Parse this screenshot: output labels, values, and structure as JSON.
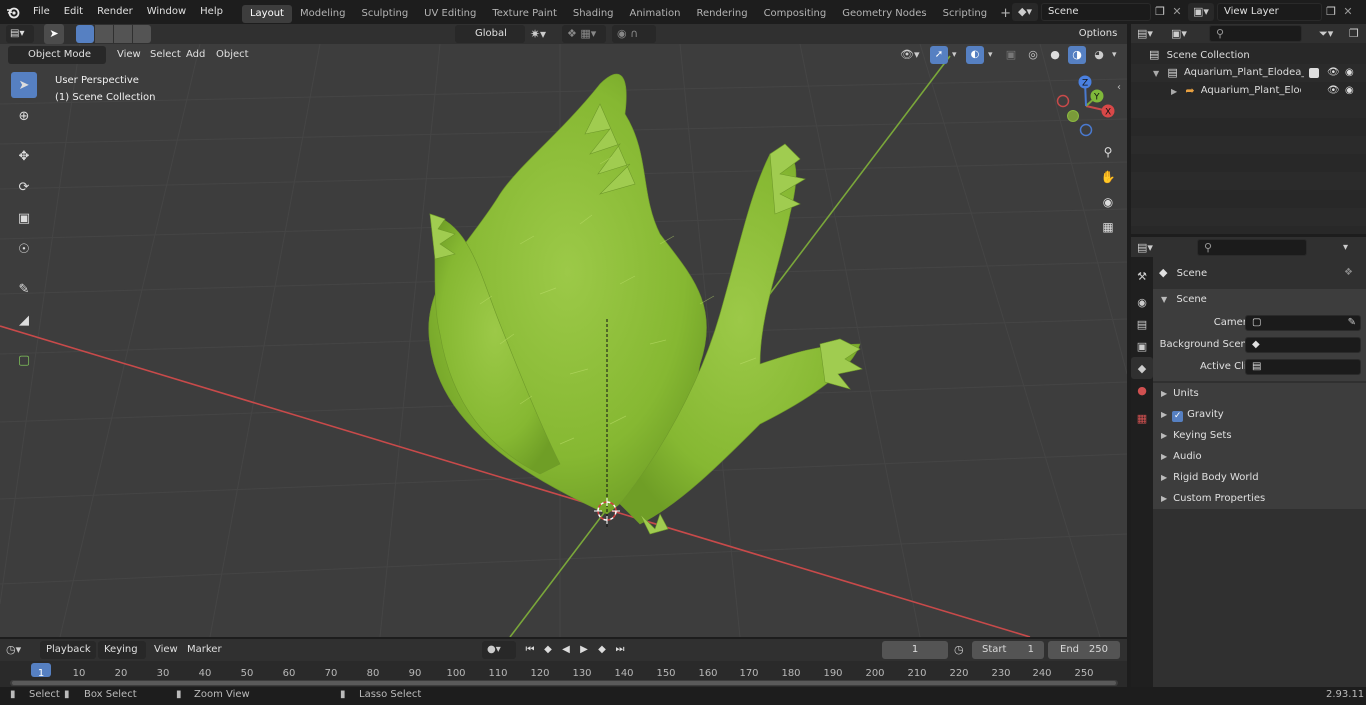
{
  "menubar": {
    "items": [
      "File",
      "Edit",
      "Render",
      "Window",
      "Help"
    ],
    "workspaces": [
      "Layout",
      "Modeling",
      "Sculpting",
      "UV Editing",
      "Texture Paint",
      "Shading",
      "Animation",
      "Rendering",
      "Compositing",
      "Geometry Nodes",
      "Scripting"
    ],
    "active_workspace": "Layout",
    "add_tab": "+",
    "scene_name": "Scene",
    "view_layer": "View Layer"
  },
  "viewport_header": {
    "mode": "Object Mode",
    "menus": [
      "View",
      "Select",
      "Add",
      "Object"
    ],
    "orientation": "Global",
    "options": "Options"
  },
  "viewport": {
    "perspective": "User Perspective",
    "collection": "(1) Scene Collection",
    "gizmo_axes": {
      "x": "X",
      "y": "Y",
      "z": "Z"
    }
  },
  "outliner": {
    "root": "Scene Collection",
    "items": [
      {
        "label": "Aquarium_Plant_Elodea_Your"
      },
      {
        "label": "Aquarium_Plant_Elodea_"
      }
    ]
  },
  "properties": {
    "context": "Scene",
    "panel": "Scene",
    "camera_label": "Camera",
    "bg_scene_label": "Background Scene",
    "active_clip_label": "Active Clip",
    "sections": [
      "Units",
      "Gravity",
      "Keying Sets",
      "Audio",
      "Rigid Body World",
      "Custom Properties"
    ]
  },
  "timeline": {
    "menus": [
      "Playback",
      "Keying",
      "View",
      "Marker"
    ],
    "current_frame": "1",
    "start_label": "Start",
    "start_value": "1",
    "end_label": "End",
    "end_value": "250",
    "ticks": [
      "1",
      "10",
      "20",
      "30",
      "40",
      "50",
      "60",
      "70",
      "80",
      "90",
      "100",
      "110",
      "120",
      "130",
      "140",
      "150",
      "160",
      "170",
      "180",
      "190",
      "200",
      "210",
      "220",
      "230",
      "240",
      "250"
    ]
  },
  "statusbar": {
    "select": "Select",
    "box_select": "Box Select",
    "zoom_view": "Zoom View",
    "lasso_select": "Lasso Select",
    "version": "2.93.11"
  },
  "colors": {
    "accent": "#5680c2",
    "x_axis": "#c84a4a",
    "y_axis": "#7aa73a",
    "plant": "#8fbf3a"
  }
}
